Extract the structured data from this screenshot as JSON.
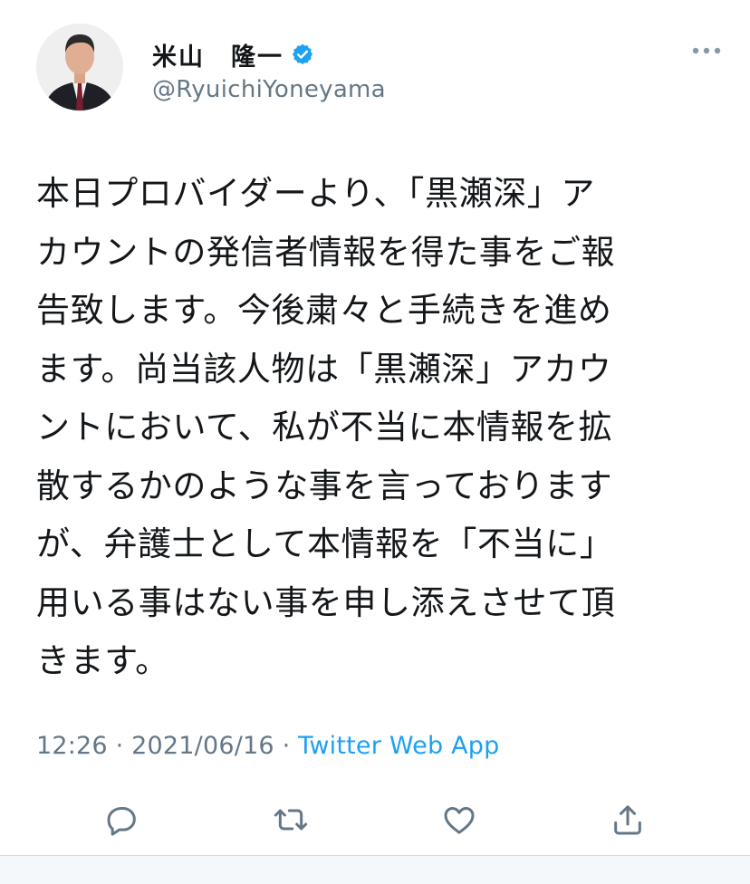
{
  "header": {
    "display_name": "米山　隆一",
    "handle": "@RyuichiYoneyama",
    "verified_icon": "verified-badge-icon",
    "more_icon": "more-options-icon"
  },
  "tweet": {
    "lines": [
      "本日プロバイダーより、「黒瀬深」ア",
      "カウントの発信者情報を得た事をご報",
      "告致します。今後粛々と手続きを進め",
      "ます。尚当該人物は「黒瀬深」アカウ",
      "ントにおいて、私が不当に本情報を拡",
      "散するかのような事を言っております",
      "が、弁護士として本情報を「不当に」",
      "用いる事はない事を申し添えさせて頂",
      "きます。"
    ]
  },
  "meta": {
    "time": "12:26",
    "separator1": " · ",
    "date": "2021/06/16",
    "separator2": " · ",
    "source": "Twitter Web App"
  },
  "actions": {
    "reply_icon": "reply-icon",
    "retweet_icon": "retweet-icon",
    "like_icon": "like-icon",
    "share_icon": "share-icon"
  },
  "colors": {
    "text": "#14171a",
    "muted": "#657786",
    "accent": "#1da1f2"
  }
}
